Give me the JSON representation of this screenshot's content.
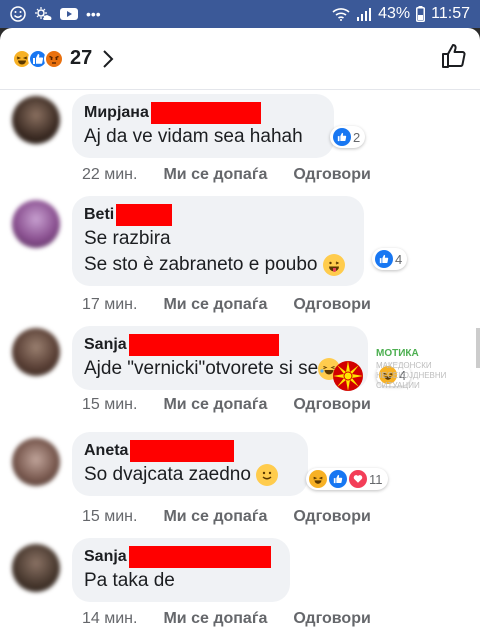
{
  "status": {
    "battery_pct": "43%",
    "time": "11:57"
  },
  "header": {
    "reaction_count": "27",
    "reactions": [
      "haha",
      "like",
      "angry"
    ],
    "colors": {
      "like": "#1877f2",
      "haha": "#f7b125",
      "angry": "#e9710f",
      "love": "#f33e58"
    }
  },
  "comments": [
    {
      "name": "Мирјана",
      "text": "Aj da ve vidam sea hahah",
      "time": "22 мин.",
      "like_label": "Ми се допаѓа",
      "reply_label": "Одговори",
      "reaction_count": "2",
      "reactions": [
        "like"
      ]
    },
    {
      "name": "Beti",
      "text_line1": "Se razbira",
      "text_line2": "Se sto è zabraneto e poubo",
      "time": "17 мин.",
      "like_label": "Ми се допаѓа",
      "reply_label": "Одговори",
      "reaction_count": "4",
      "reactions": [
        "like"
      ]
    },
    {
      "name": "Sanja",
      "text": "Ajde \"vernicki\"otvorete si se",
      "time": "15 мин.",
      "like_label": "Ми се допаѓа",
      "reply_label": "Одговори",
      "reaction_count": "4",
      "reactions": [
        "haha"
      ]
    },
    {
      "name": "Aneta",
      "text": "So dvajcata zaedno",
      "time": "15 мин.",
      "like_label": "Ми се допаѓа",
      "reply_label": "Одговори",
      "reaction_count": "11",
      "reactions": [
        "haha",
        "like",
        "love"
      ]
    },
    {
      "name": "Sanja",
      "text": "Pa taka de",
      "time": "14 мин.",
      "like_label": "Ми се допаѓа",
      "reply_label": "Одговори"
    }
  ],
  "watermark": {
    "title": "МОТИКА",
    "line1": "МАКЕДОНСКИ",
    "line2": "НЕСЕКОЈДНЕВНИ",
    "line3": "СИТУАЦИИ"
  }
}
